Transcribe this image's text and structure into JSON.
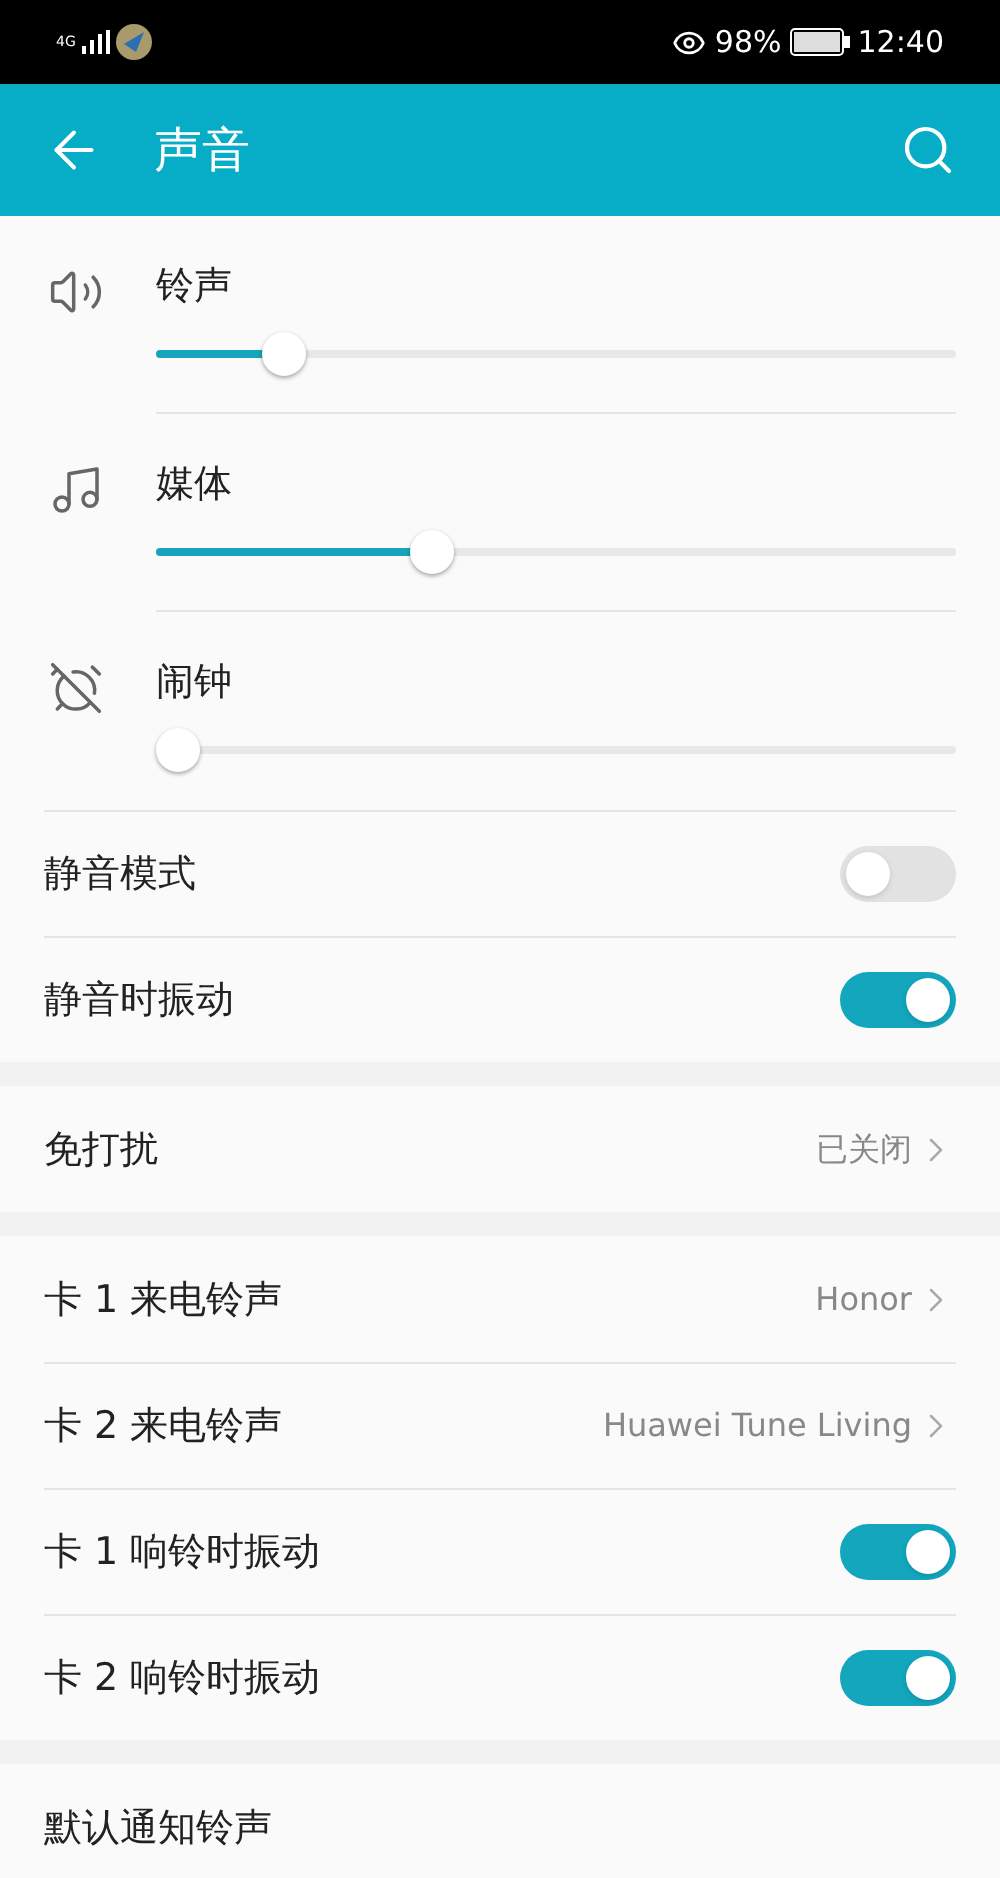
{
  "status_bar": {
    "network": "4G",
    "battery": "98%",
    "time": "12:40"
  },
  "header": {
    "title": "声音"
  },
  "volumes": [
    {
      "kind": "ring",
      "label": "铃声",
      "level": 0.14
    },
    {
      "kind": "media",
      "label": "媒体",
      "level": 0.335
    },
    {
      "kind": "alarm",
      "label": "闹钟",
      "level": 0
    }
  ],
  "sections": [
    {
      "items": [
        {
          "kind": "toggle",
          "label": "静音模式",
          "on": false
        },
        {
          "kind": "toggle",
          "label": "静音时振动",
          "on": true
        }
      ]
    },
    {
      "items": [
        {
          "kind": "link",
          "label": "免打扰",
          "value": "已关闭"
        }
      ]
    },
    {
      "items": [
        {
          "kind": "link",
          "label": "卡 1 来电铃声",
          "value": "Honor"
        },
        {
          "kind": "link",
          "label": "卡 2 来电铃声",
          "value": "Huawei Tune Living"
        },
        {
          "kind": "toggle",
          "label": "卡 1 响铃时振动",
          "on": true
        },
        {
          "kind": "toggle",
          "label": "卡 2 响铃时振动",
          "on": true
        }
      ]
    },
    {
      "items": [
        {
          "kind": "link",
          "label": "默认通知铃声"
        }
      ]
    }
  ]
}
